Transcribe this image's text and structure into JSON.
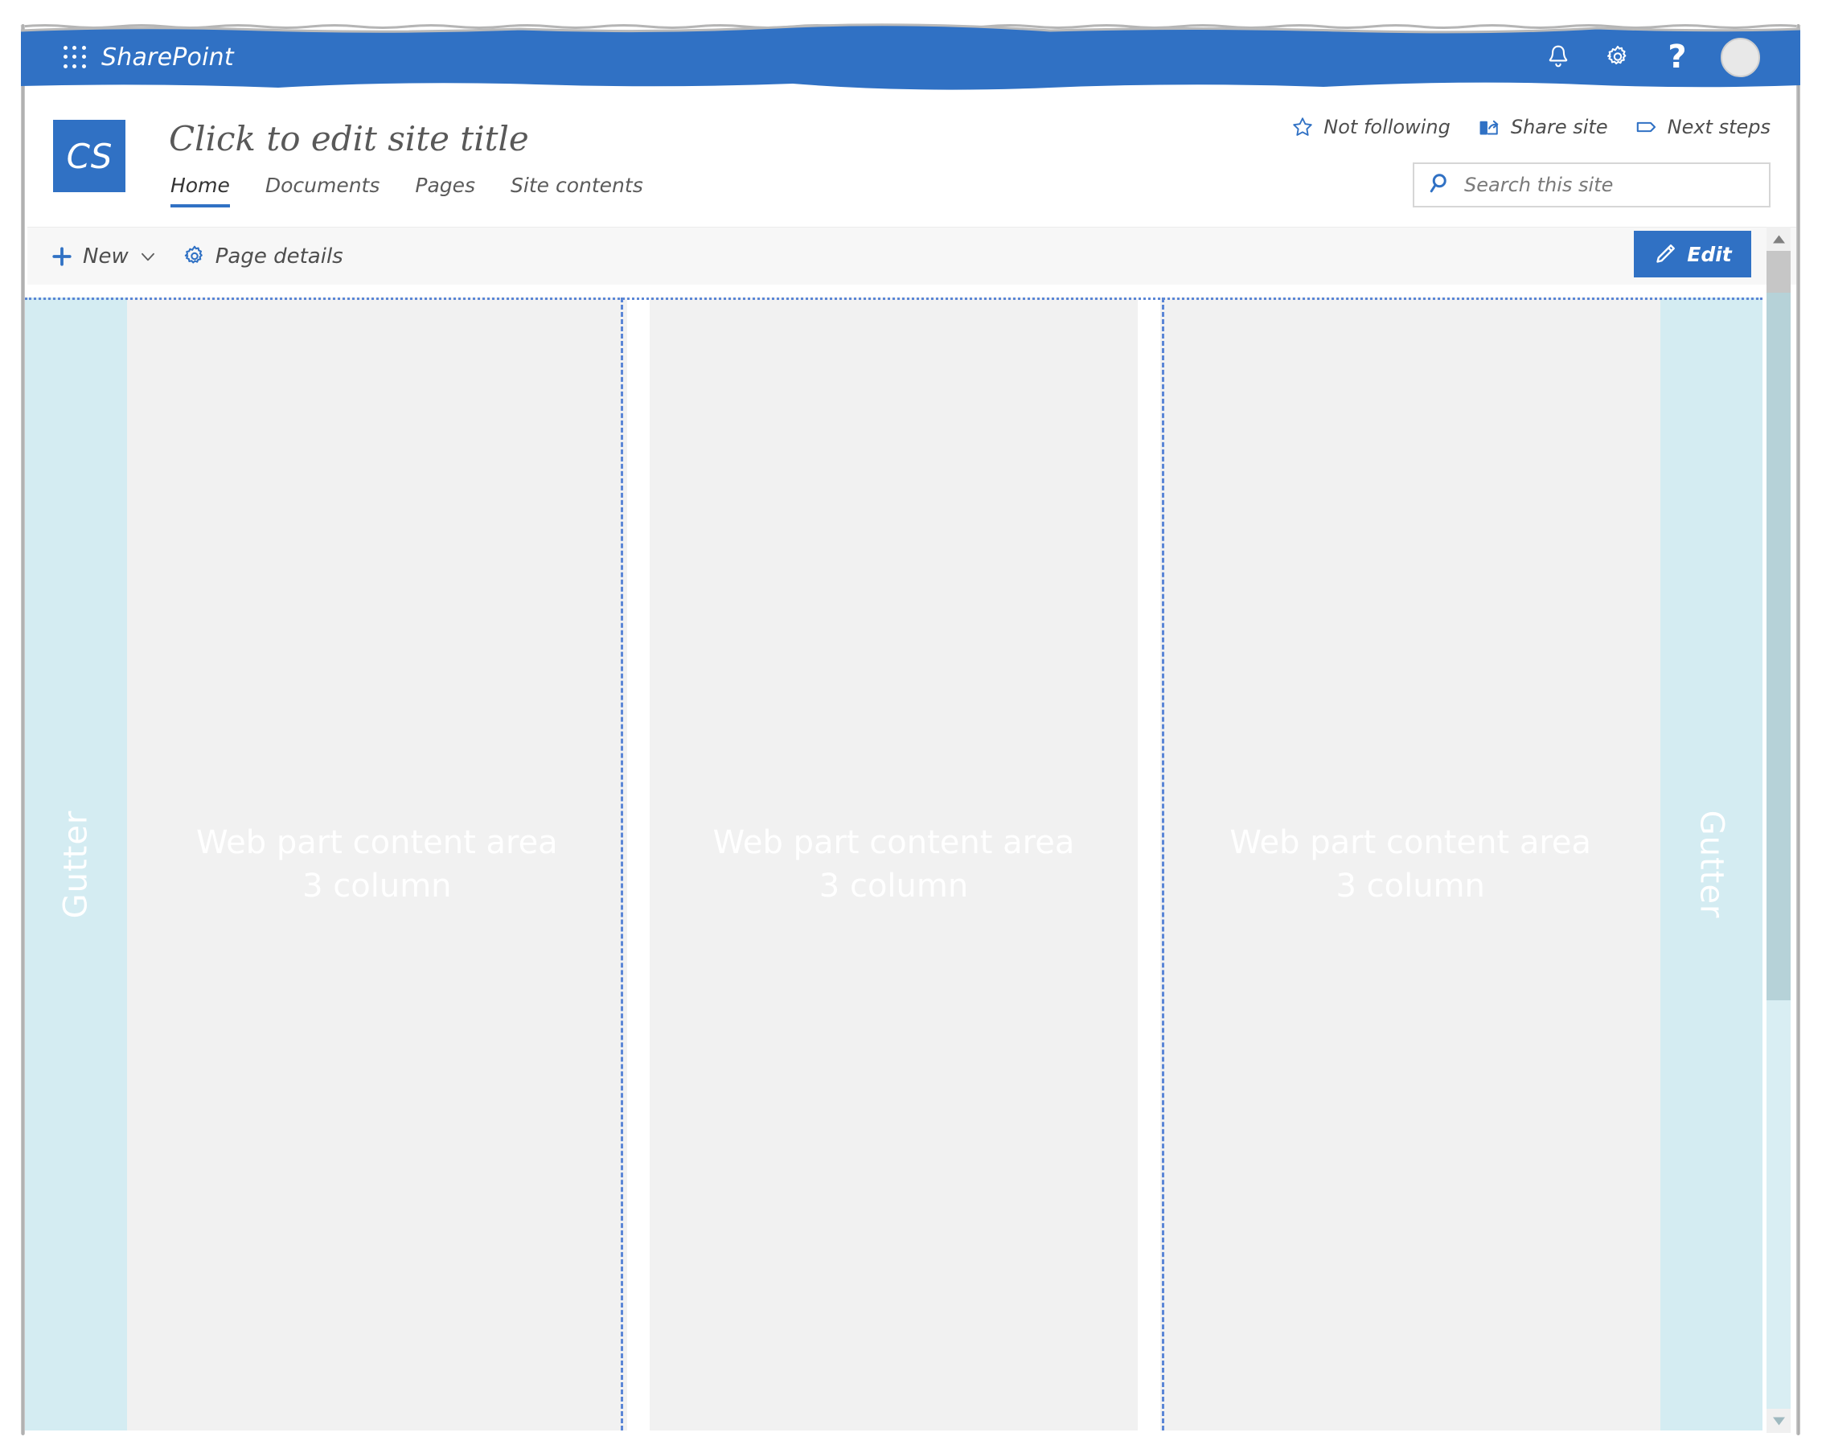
{
  "suite_bar": {
    "waffle_icon": "app-launcher-waffle-icon",
    "brand": "SharePoint",
    "actions": [
      {
        "name": "notifications-icon",
        "label": "Notifications"
      },
      {
        "name": "settings-gear-icon",
        "label": "Settings"
      },
      {
        "name": "help-question-icon",
        "label": "?"
      },
      {
        "name": "user-avatar",
        "label": "Account manager"
      }
    ]
  },
  "site_header": {
    "logo_initials": "CS",
    "title": "Click to edit site title",
    "nav": [
      {
        "label": "Home",
        "active": true
      },
      {
        "label": "Documents",
        "active": false
      },
      {
        "label": "Pages",
        "active": false
      },
      {
        "label": "Site contents",
        "active": false
      }
    ],
    "commands": [
      {
        "label": "Not following",
        "icon": "star-outline-icon"
      },
      {
        "label": "Share site",
        "icon": "share-icon"
      },
      {
        "label": "Next steps",
        "icon": "megaphone-icon"
      }
    ],
    "search": {
      "placeholder": "Search this site",
      "value": "",
      "icon": "search-icon"
    }
  },
  "command_bar": {
    "new_label": "New",
    "new_icon": "plus-icon",
    "new_chevron": "chevron-down-icon",
    "page_details_label": "Page details",
    "page_details_icon": "gear-icon",
    "edit_label": "Edit",
    "edit_icon": "pencil-icon"
  },
  "canvas": {
    "gutter_left_label": "Gutter",
    "gutter_right_label": "Gutter",
    "columns": [
      {
        "line1": "Web part content area",
        "line2": "3 column"
      },
      {
        "line1": "Web part content area",
        "line2": "3 column"
      },
      {
        "line1": "Web part content area",
        "line2": "3 column"
      }
    ]
  },
  "colors": {
    "brand_blue": "#3071c4",
    "gutter_blue": "#d4ecf2",
    "content_gray": "#f1f1f1",
    "divider_blue": "#5b86d6",
    "command_bar_gray": "#f7f7f7",
    "scrollbar_thumb": "#b6d2d8"
  }
}
